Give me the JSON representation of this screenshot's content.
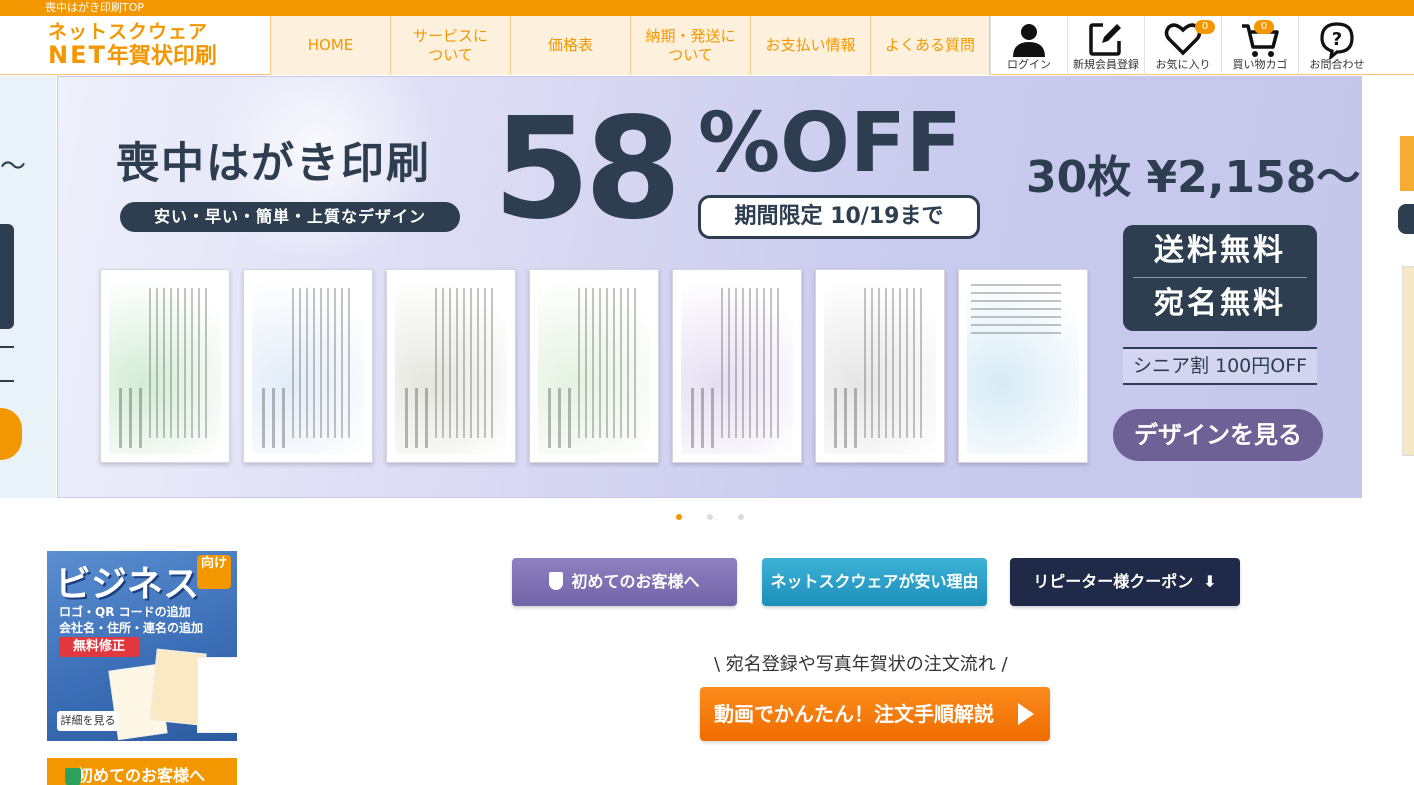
{
  "topbar": {
    "text": "喪中はがき印刷TOP"
  },
  "logo": {
    "line1": "ネットスクウェア",
    "net": "NET",
    "line2": "年賀状印刷"
  },
  "nav": {
    "items": [
      {
        "label": "HOME"
      },
      {
        "label": "サービスに\nついて"
      },
      {
        "label": "価格表"
      },
      {
        "label": "納期・発送に\nついて"
      },
      {
        "label": "お支払い情報"
      },
      {
        "label": "よくある質問"
      }
    ]
  },
  "utils": {
    "login": "ログイン",
    "register": "新規会員登録",
    "favorites": "お気に入り",
    "favorites_count": "0",
    "cart": "買い物カゴ",
    "cart_count": "0",
    "contact": "お問合わせ"
  },
  "banner": {
    "title": "喪中はがき印刷",
    "subtitle": "安い・早い・簡単・上質なデザイン",
    "discount_number": "58",
    "discount_suffix": "%OFF",
    "period": "期間限定 10/19まで",
    "price": "30枚 ¥2,158〜",
    "free_shipping": "送料無料",
    "free_address": "宛名無料",
    "senior": "シニア割 100円OFF",
    "design_button": "デザインを見る",
    "card_colors": [
      "#d3ecd6",
      "#e3ecf7",
      "#e6e6e0",
      "#e5f2e2",
      "#e6def2",
      "#e6e6e6",
      "#d7ebf6"
    ]
  },
  "carousel": {
    "active": 0,
    "count": 3
  },
  "business": {
    "title": "ビジネス",
    "tag": "向け",
    "line1": "ロゴ・QR コードの追加",
    "line2": "会社名・住所・連名の追加",
    "fix": "無料修正",
    "more": "詳細を見る"
  },
  "first_left": {
    "label": "初めてのお客様へ"
  },
  "buttons": {
    "first": "初めてのお客様へ",
    "cheap": "ネットスクウェアが安い理由",
    "coupon": "リピーター様クーポン"
  },
  "flow": {
    "text": "\\ 宛名登録や写真年賀状の注文流れ /",
    "video": "動画でかんたん！注文手順解説"
  },
  "colors": {
    "accent": "#f39700",
    "navy": "#2c3e50"
  }
}
